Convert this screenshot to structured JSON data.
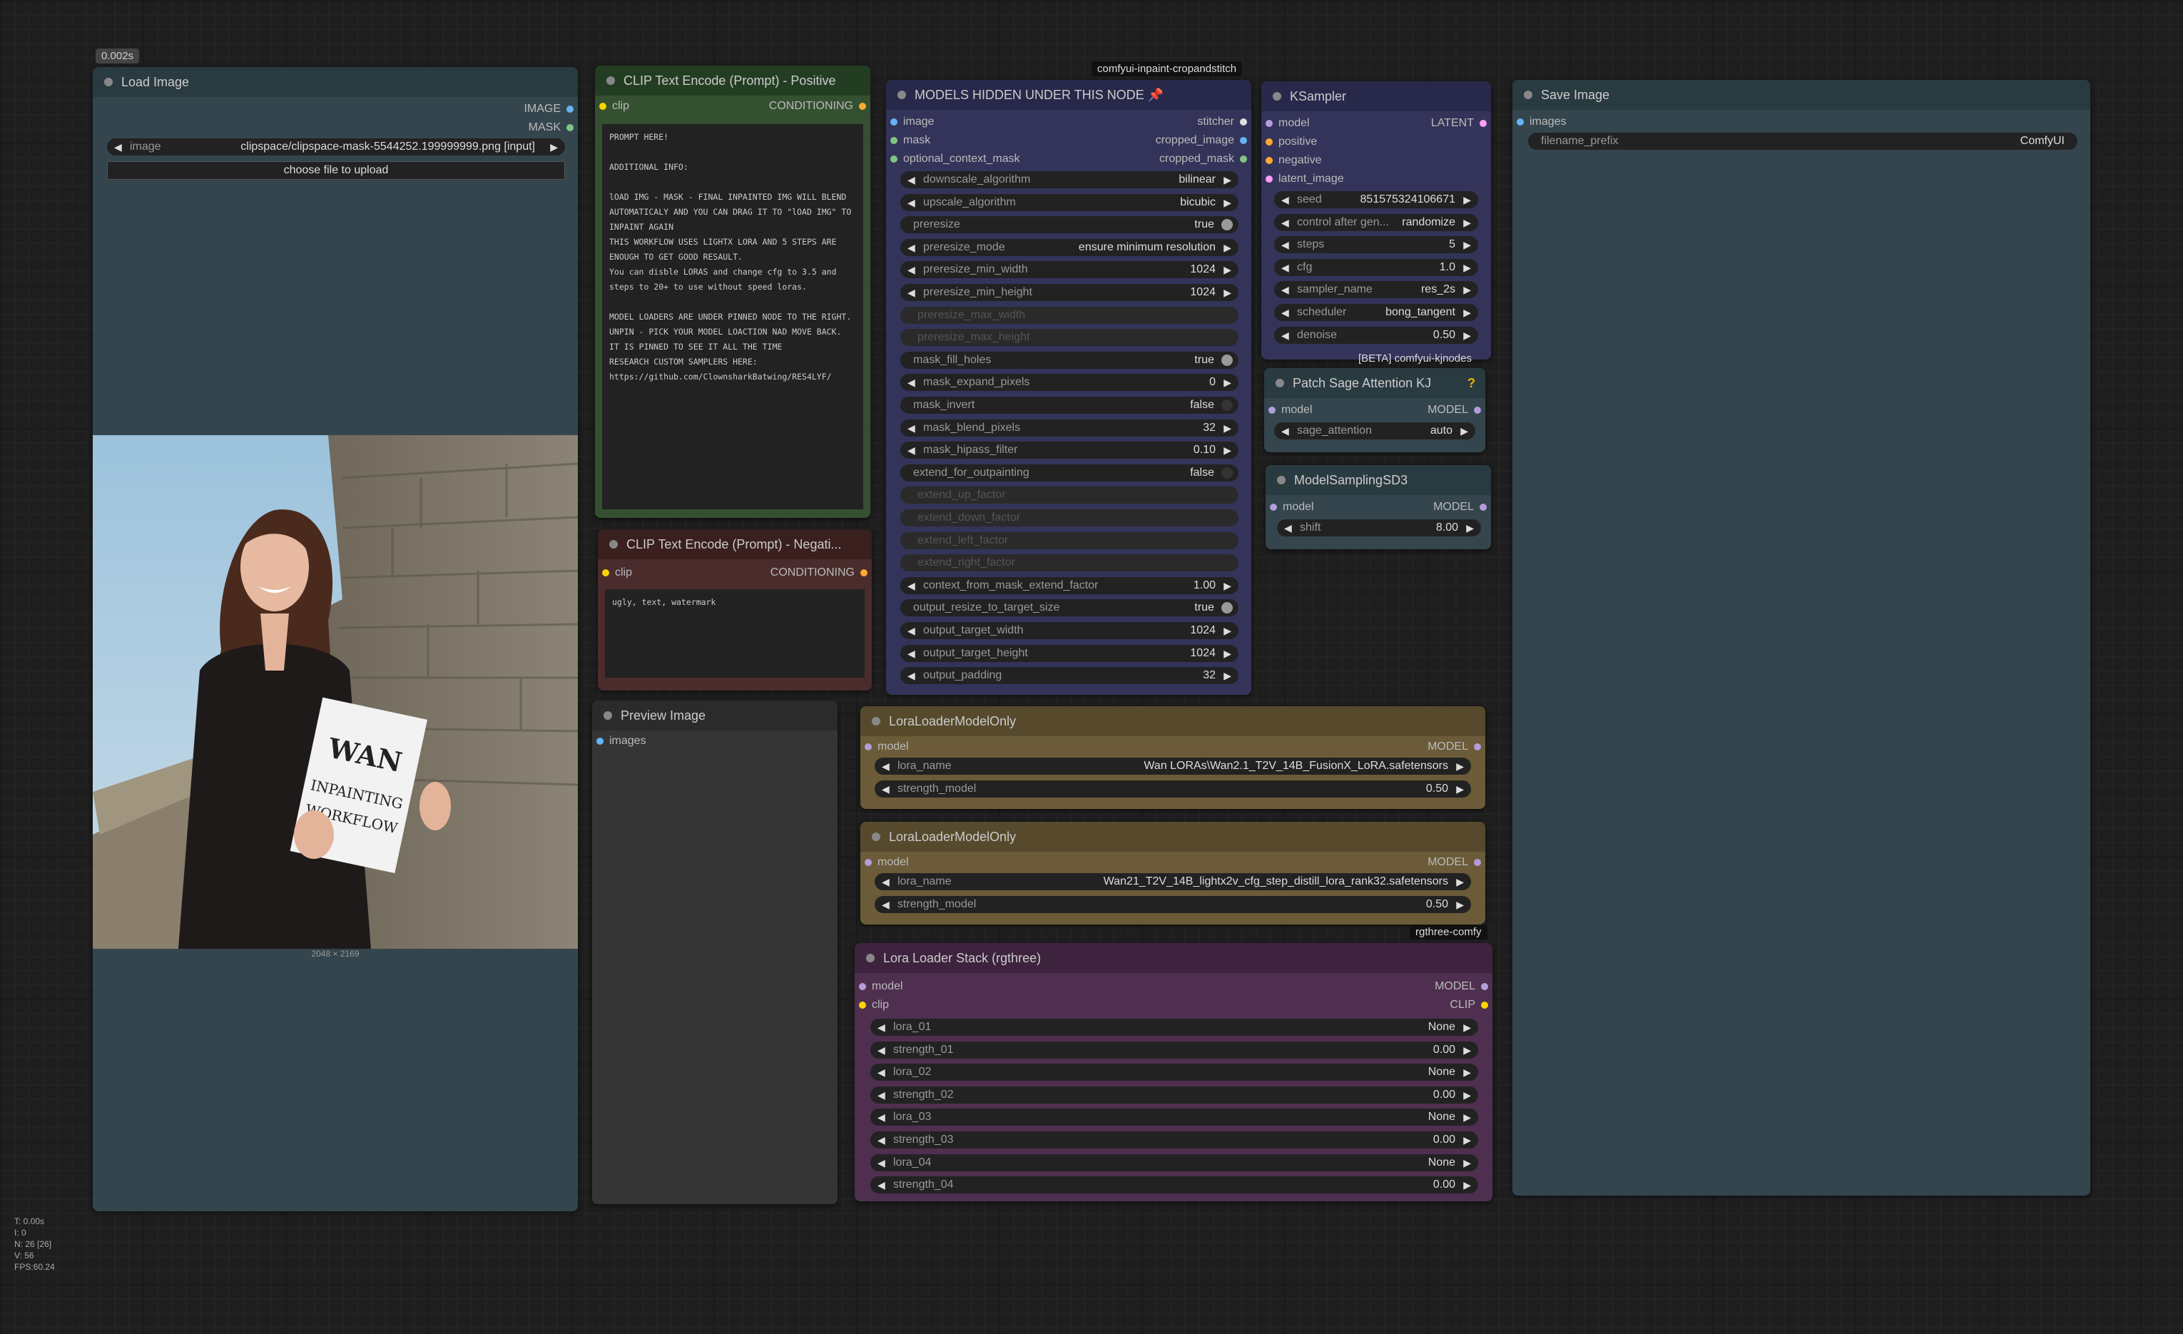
{
  "exec_time_badge": "0.002s",
  "stats": {
    "t": "T: 0.00s",
    "i": "I: 0",
    "n": "N: 26 [26]",
    "v": "V: 56",
    "fps": "FPS:60.24"
  },
  "colors": {
    "image_pin": "#64b5f6",
    "mask_pin": "#81c784",
    "clip_pin": "#ffd500",
    "conditioning_pin": "#ffa931",
    "model_pin": "#b39ddb",
    "latent_pin": "#ff9cf9"
  },
  "load_image": {
    "title": "Load Image",
    "out_image": "IMAGE",
    "out_mask": "MASK",
    "image_label": "image",
    "image_value": "clipspace/clipspace-mask-5544252.199999999.png [input]",
    "upload_button": "choose file to upload",
    "photo_alt": "woman holding sign",
    "sign_l1": "WAN",
    "sign_l2": "INPAINTING",
    "sign_l3": "WORKFLOW",
    "size_caption": "2048 × 2169"
  },
  "clip_pos": {
    "title": "CLIP Text Encode (Prompt) - Positive",
    "in_clip": "clip",
    "out": "CONDITIONING",
    "text": "PROMPT HERE!\n\nADDITIONAL INFO:\n\nlOAD IMG - MASK - FINAL INPAINTED IMG WILL BLEND AUTOMATICALY AND YOU CAN DRAG IT TO \"lOAD IMG\" TO INPAINT AGAIN\nTHIS WORKFLOW USES LIGHTX LORA AND 5 STEPS ARE ENOUGH TO GET GOOD RESAULT.\nYou can disble LORAS and change cfg to 3.5 and steps to 20+ to use without speed loras.\n\nMODEL LOADERS ARE UNDER PINNED NODE TO THE RIGHT. UNPIN - PICK YOUR MODEL LOACTION NAD MOVE BACK. IT IS PINNED TO SEE IT ALL THE TIME\nRESEARCH CUSTOM SAMPLERS HERE:\nhttps://github.com/ClownsharkBatwing/RES4LYF/"
  },
  "clip_neg": {
    "title": "CLIP Text Encode (Prompt) - Negati...",
    "in_clip": "clip",
    "out": "CONDITIONING",
    "text": "ugly, text, watermark"
  },
  "preview": {
    "title": "Preview Image",
    "in_images": "images"
  },
  "crop": {
    "badge": "comfyui-inpaint-cropandstitch",
    "title": "MODELS HIDDEN UNDER THIS NODE",
    "pin_icon": "pushpin-icon",
    "inputs": [
      "image",
      "mask",
      "optional_context_mask"
    ],
    "outputs": [
      "stitcher",
      "cropped_image",
      "cropped_mask"
    ],
    "widgets": [
      {
        "label": "downscale_algorithm",
        "value": "bilinear",
        "kind": "combo"
      },
      {
        "label": "upscale_algorithm",
        "value": "bicubic",
        "kind": "combo"
      },
      {
        "label": "preresize",
        "value": "true",
        "kind": "toggle"
      },
      {
        "label": "preresize_mode",
        "value": "ensure minimum resolution",
        "kind": "combo"
      },
      {
        "label": "preresize_min_width",
        "value": "1024",
        "kind": "num"
      },
      {
        "label": "preresize_min_height",
        "value": "1024",
        "kind": "num"
      },
      {
        "label": "preresize_max_width",
        "value": "",
        "kind": "disabled"
      },
      {
        "label": "preresize_max_height",
        "value": "",
        "kind": "disabled"
      },
      {
        "label": "mask_fill_holes",
        "value": "true",
        "kind": "toggle"
      },
      {
        "label": "mask_expand_pixels",
        "value": "0",
        "kind": "num"
      },
      {
        "label": "mask_invert",
        "value": "false",
        "kind": "toggle"
      },
      {
        "label": "mask_blend_pixels",
        "value": "32",
        "kind": "num"
      },
      {
        "label": "mask_hipass_filter",
        "value": "0.10",
        "kind": "num"
      },
      {
        "label": "extend_for_outpainting",
        "value": "false",
        "kind": "toggle"
      },
      {
        "label": "extend_up_factor",
        "value": "",
        "kind": "disabled"
      },
      {
        "label": "extend_down_factor",
        "value": "",
        "kind": "disabled"
      },
      {
        "label": "extend_left_factor",
        "value": "",
        "kind": "disabled"
      },
      {
        "label": "extend_right_factor",
        "value": "",
        "kind": "disabled"
      },
      {
        "label": "context_from_mask_extend_factor",
        "value": "1.00",
        "kind": "num"
      },
      {
        "label": "output_resize_to_target_size",
        "value": "true",
        "kind": "toggle"
      },
      {
        "label": "output_target_width",
        "value": "1024",
        "kind": "num"
      },
      {
        "label": "output_target_height",
        "value": "1024",
        "kind": "num"
      },
      {
        "label": "output_padding",
        "value": "32",
        "kind": "num"
      }
    ]
  },
  "ksampler": {
    "title": "KSampler",
    "inputs": [
      "model",
      "positive",
      "negative",
      "latent_image"
    ],
    "out": "LATENT",
    "widgets": [
      {
        "label": "seed",
        "value": "851575324106671"
      },
      {
        "label": "control after gen...",
        "value": "randomize"
      },
      {
        "label": "steps",
        "value": "5"
      },
      {
        "label": "cfg",
        "value": "1.0"
      },
      {
        "label": "sampler_name",
        "value": "res_2s"
      },
      {
        "label": "scheduler",
        "value": "bong_tangent"
      },
      {
        "label": "denoise",
        "value": "0.50"
      }
    ],
    "badge": "[BETA] comfyui-kjnodes"
  },
  "sage": {
    "title": "Patch Sage Attention KJ",
    "help": "?",
    "in_model": "model",
    "out": "MODEL",
    "w_label": "sage_attention",
    "w_value": "auto"
  },
  "msd3": {
    "title": "ModelSamplingSD3",
    "in_model": "model",
    "out": "MODEL",
    "w_label": "shift",
    "w_value": "8.00"
  },
  "lora1": {
    "title": "LoraLoaderModelOnly",
    "in_model": "model",
    "out": "MODEL",
    "name_label": "lora_name",
    "name_value": "Wan LORAs\\Wan2.1_T2V_14B_FusionX_LoRA.safetensors",
    "str_label": "strength_model",
    "str_value": "0.50"
  },
  "lora2": {
    "title": "LoraLoaderModelOnly",
    "in_model": "model",
    "out": "MODEL",
    "name_label": "lora_name",
    "name_value": "Wan21_T2V_14B_lightx2v_cfg_step_distill_lora_rank32.safetensors",
    "str_label": "strength_model",
    "str_value": "0.50",
    "badge": "rgthree-comfy"
  },
  "stack": {
    "title": "Lora Loader Stack (rgthree)",
    "in_model": "model",
    "in_clip": "clip",
    "out_model": "MODEL",
    "out_clip": "CLIP",
    "widgets": [
      {
        "label": "lora_01",
        "value": "None"
      },
      {
        "label": "strength_01",
        "value": "0.00"
      },
      {
        "label": "lora_02",
        "value": "None"
      },
      {
        "label": "strength_02",
        "value": "0.00"
      },
      {
        "label": "lora_03",
        "value": "None"
      },
      {
        "label": "strength_03",
        "value": "0.00"
      },
      {
        "label": "lora_04",
        "value": "None"
      },
      {
        "label": "strength_04",
        "value": "0.00"
      }
    ]
  },
  "save": {
    "title": "Save Image",
    "in_images": "images",
    "w_label": "filename_prefix",
    "w_value": "ComfyUI"
  }
}
